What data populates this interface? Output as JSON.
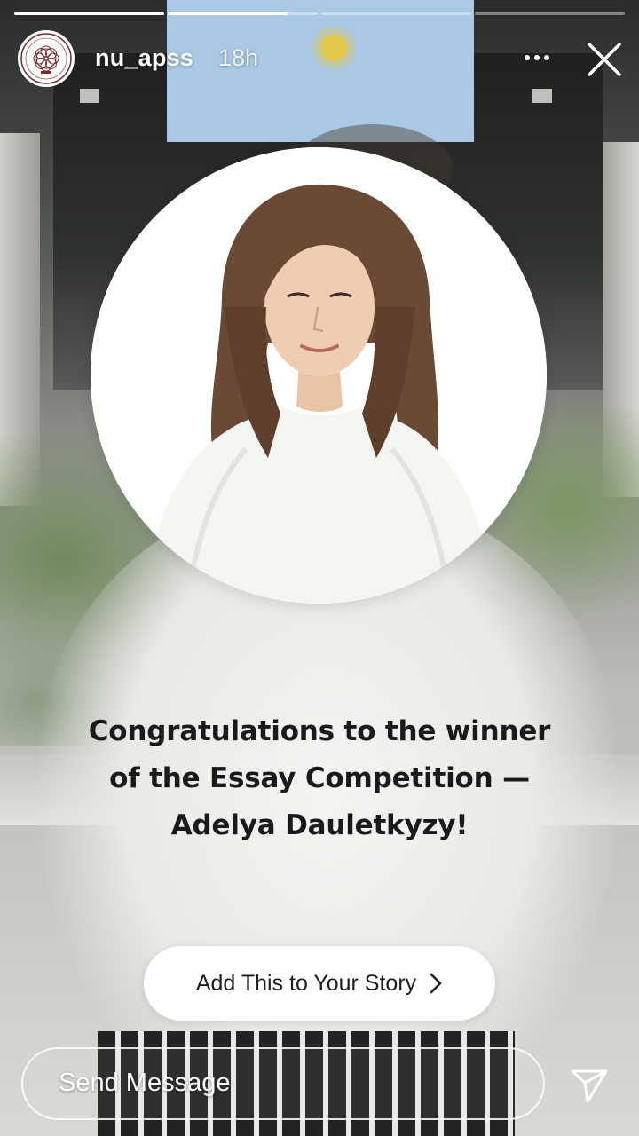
{
  "story": {
    "progress": [
      {
        "state": "viewed",
        "fill": 1.0
      },
      {
        "state": "current",
        "fill": 0.8
      },
      {
        "state": "upcoming",
        "fill": 0.0
      },
      {
        "state": "upcoming",
        "fill": 0.0
      }
    ],
    "header": {
      "username": "nu_apss",
      "time_ago": "18h",
      "avatar_icon": "organization-logo-icon",
      "more_icon": "more-options-icon",
      "close_icon": "close-icon"
    },
    "caption": {
      "line1": "Congratulations to the winner",
      "line2": "of the Essay Competition —",
      "line3": "Adelya Dauletkyzy!"
    },
    "add_story": {
      "label": "Add This to Your Story",
      "icon": "chevron-right-icon"
    },
    "message": {
      "placeholder": "Send Message",
      "send_icon": "paper-plane-icon"
    },
    "colors": {
      "text_dark": "#1a1a1a",
      "white": "#ffffff",
      "logo_maroon": "#7a2b2b"
    }
  }
}
